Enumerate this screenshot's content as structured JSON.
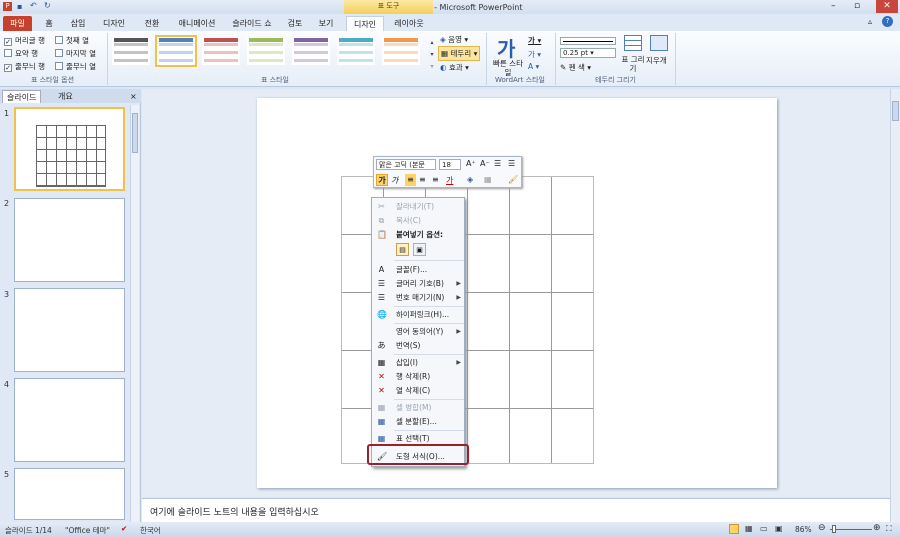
{
  "window": {
    "title": "새 프레젠테이션 - Microsoft PowerPoint",
    "context_group": "표 도구"
  },
  "tabs": [
    {
      "label": "파일"
    },
    {
      "label": "홈"
    },
    {
      "label": "삽입"
    },
    {
      "label": "디자인"
    },
    {
      "label": "전환"
    },
    {
      "label": "애니메이션"
    },
    {
      "label": "슬라이드 쇼"
    },
    {
      "label": "검토"
    },
    {
      "label": "보기"
    },
    {
      "label": "디자인"
    },
    {
      "label": "레이아웃"
    }
  ],
  "ribbon": {
    "table_style_options": {
      "items": [
        {
          "label": "머리글 행",
          "checked": true
        },
        {
          "label": "첫째 열",
          "checked": false
        },
        {
          "label": "요약 행",
          "checked": false
        },
        {
          "label": "마지막 열",
          "checked": false
        },
        {
          "label": "줄무늬 행",
          "checked": true
        },
        {
          "label": "줄무늬 열",
          "checked": false
        }
      ],
      "group_label": "표 스타일 옵션"
    },
    "table_styles": {
      "group_label": "표 스타일",
      "shading": "음영",
      "borders": "테두리",
      "effects": "효과",
      "colors": [
        "#555555",
        "#4f81bd",
        "#c0504d",
        "#9bbb59",
        "#8064a2",
        "#4bacc6",
        "#f79646"
      ]
    },
    "wordart": {
      "quick_styles": "빠른 스타일",
      "group_label": "WordArt 스타일",
      "letter": "가"
    },
    "draw_borders": {
      "pen_weight": "0.25 pt",
      "pen_color": "펜 색",
      "draw_table": "표 그리기",
      "eraser": "지우개",
      "group_label": "테두리 그리기"
    }
  },
  "left_pane": {
    "tabs": [
      "슬라이드",
      "개요"
    ],
    "close": "×",
    "slides": [
      "1",
      "2",
      "3",
      "4",
      "5"
    ]
  },
  "mini_toolbar": {
    "font": "맑은 고딕 (본문",
    "size": "18",
    "bold": "가",
    "italic": "가"
  },
  "context_menu": [
    {
      "label": "잘라내기(T)",
      "icon": "✂",
      "disabled": true
    },
    {
      "label": "복사(C)",
      "icon": "⧉",
      "disabled": true
    },
    {
      "label": "붙여넣기 옵션:",
      "icon": "📋",
      "disabled": false,
      "bold": true
    },
    {
      "label": "글꼴(F)...",
      "icon": "A",
      "disabled": false
    },
    {
      "label": "글머리 기호(B)",
      "icon": "☰",
      "disabled": false,
      "submenu": true
    },
    {
      "label": "번호 매기기(N)",
      "icon": "☰",
      "disabled": false,
      "submenu": true
    },
    {
      "label": "하이퍼링크(H)...",
      "icon": "🌐",
      "disabled": false
    },
    {
      "label": "영어 동의어(Y)",
      "icon": "",
      "disabled": false,
      "submenu": true
    },
    {
      "label": "번역(S)",
      "icon": "あ",
      "disabled": false
    },
    {
      "label": "삽입(I)",
      "icon": "▦",
      "disabled": false,
      "submenu": true
    },
    {
      "label": "행 삭제(R)",
      "icon": "✕",
      "disabled": false
    },
    {
      "label": "열 삭제(C)",
      "icon": "✕",
      "disabled": false
    },
    {
      "label": "셀 병합(M)",
      "icon": "▦",
      "disabled": true
    },
    {
      "label": "셀 분할(E)...",
      "icon": "▦",
      "disabled": false
    },
    {
      "label": "표 선택(T)",
      "icon": "▦",
      "disabled": false
    },
    {
      "label": "도형 서식(O)...",
      "icon": "🖌",
      "disabled": false
    }
  ],
  "notes_placeholder": "여기에 슬라이드 노트의 내용을 입력하십시오",
  "status": {
    "slide": "슬라이드 1/14",
    "theme": "\"Office 테마\"",
    "language": "한국어",
    "zoom": "86%"
  }
}
